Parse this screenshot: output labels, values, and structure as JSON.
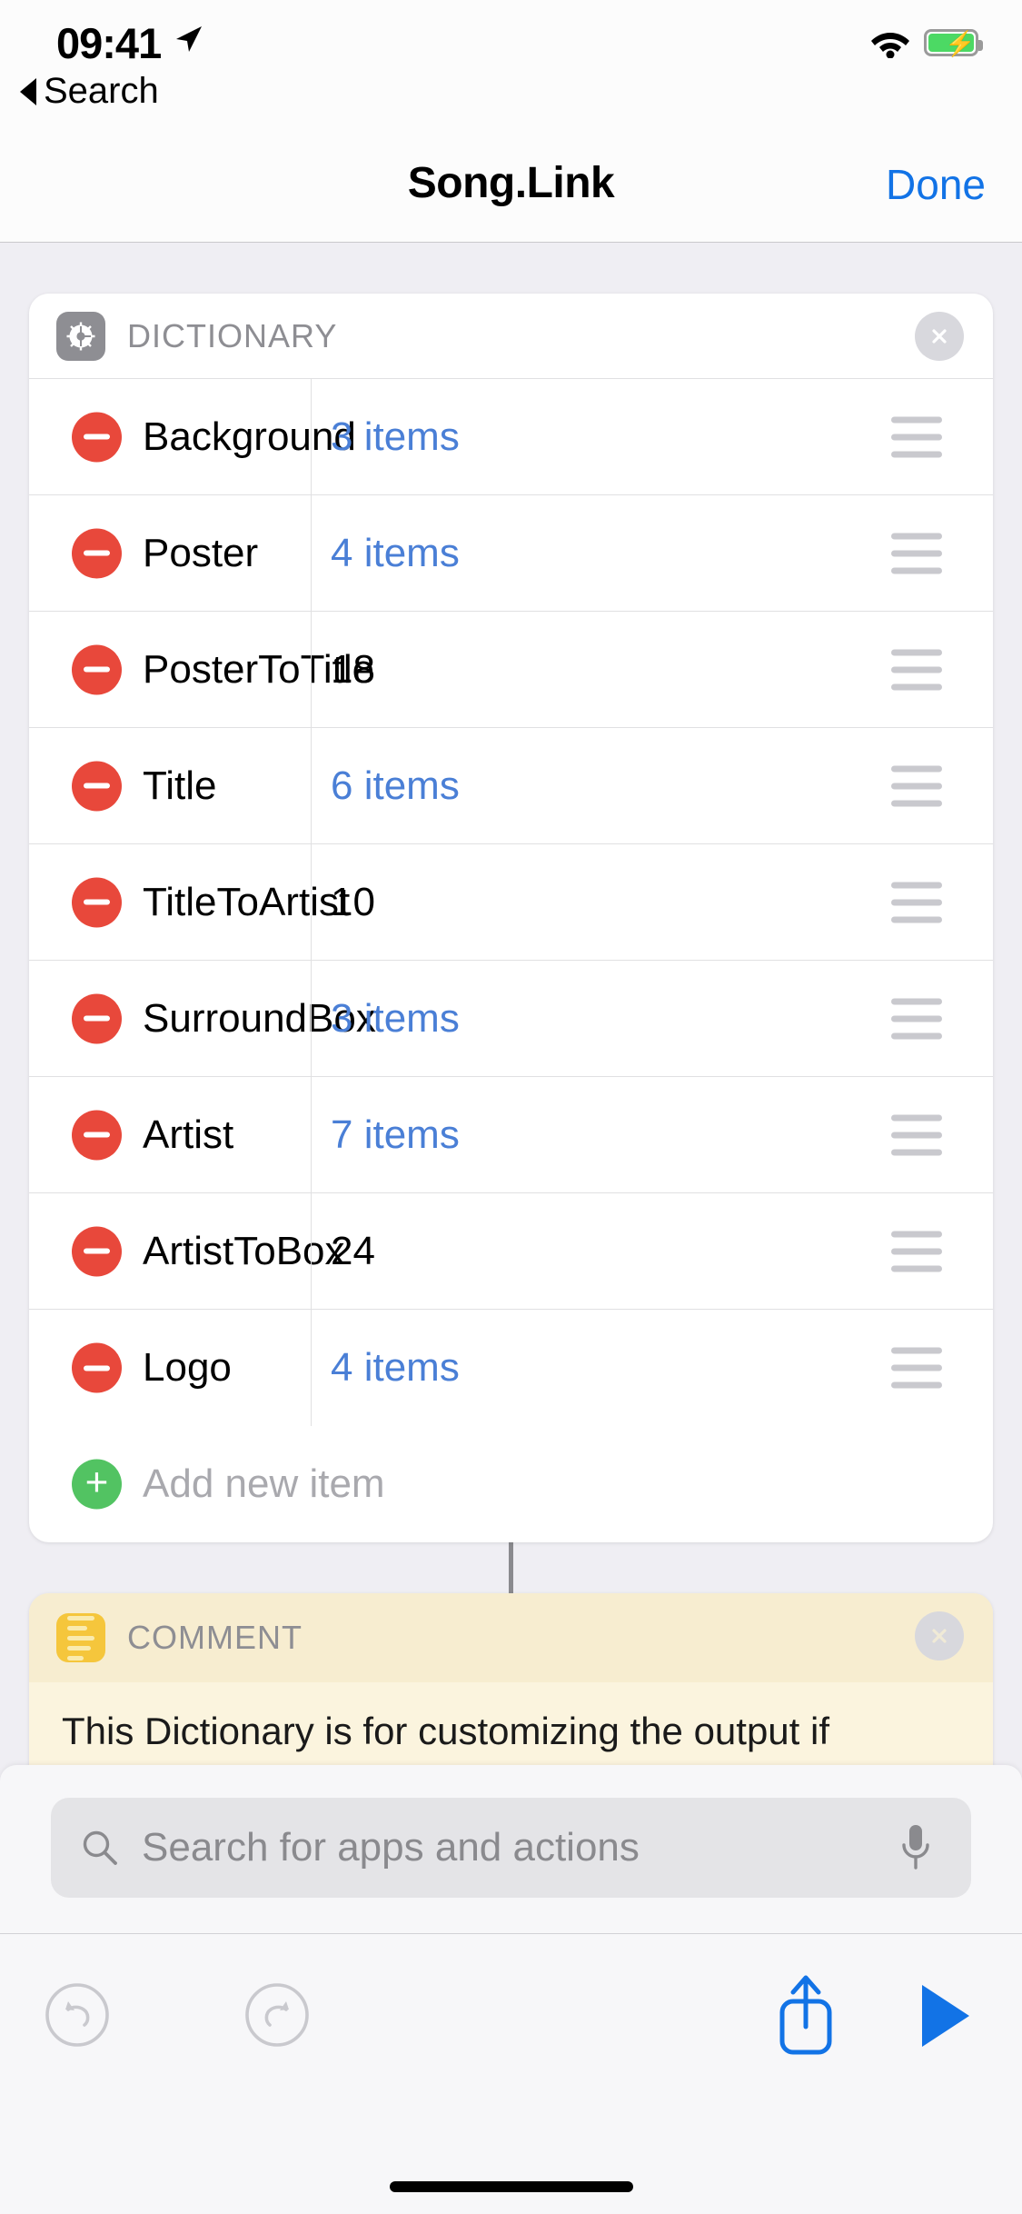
{
  "status_bar": {
    "time": "09:41",
    "back_label": "Search",
    "location_icon": "location-arrow-icon",
    "wifi_icon": "wifi-icon",
    "battery_icon": "battery-charging-icon",
    "battery_color": "#4CD964"
  },
  "nav_bar": {
    "title": "Song.Link",
    "done_label": "Done",
    "accent_color": "#1273E6"
  },
  "dictionary_card": {
    "header_label": "DICTIONARY",
    "header_icon": "gear-icon",
    "close_icon": "close-circle-icon",
    "rows": [
      {
        "key": "Background",
        "value": "3 items",
        "is_link": true
      },
      {
        "key": "Poster",
        "value": "4 items",
        "is_link": true
      },
      {
        "key": "PosterToTitle",
        "value": "18",
        "is_link": false
      },
      {
        "key": "Title",
        "value": "6 items",
        "is_link": true
      },
      {
        "key": "TitleToArtist",
        "value": "10",
        "is_link": false
      },
      {
        "key": "SurroundBox",
        "value": "3 items",
        "is_link": true
      },
      {
        "key": "Artist",
        "value": "7 items",
        "is_link": true
      },
      {
        "key": "ArtistToBox",
        "value": "24",
        "is_link": false
      },
      {
        "key": "Logo",
        "value": "4 items",
        "is_link": true
      }
    ],
    "add_row": {
      "placeholder": "Add new item",
      "icon": "plus-circle-icon"
    },
    "delete_icon": "minus-circle-icon",
    "reorder_icon": "drag-handle-icon",
    "link_color": "#4A7FD6",
    "delete_color": "#E8483B",
    "add_color": "#52C362"
  },
  "comment_card": {
    "header_label": "COMMENT",
    "header_icon": "text-lines-icon",
    "close_icon": "close-circle-icon",
    "body_text": "This Dictionary is for customizing the output if",
    "background_color": "#FBF4DE",
    "icon_color": "#F5C63C"
  },
  "search": {
    "placeholder": "Search for apps and actions",
    "search_icon": "search-icon",
    "mic_icon": "microphone-icon"
  },
  "toolbar": {
    "undo_icon": "undo-icon",
    "redo_icon": "redo-icon",
    "share_icon": "share-icon",
    "play_icon": "play-icon",
    "accent_color": "#1273E6",
    "disabled_color": "#C9C9CE"
  }
}
